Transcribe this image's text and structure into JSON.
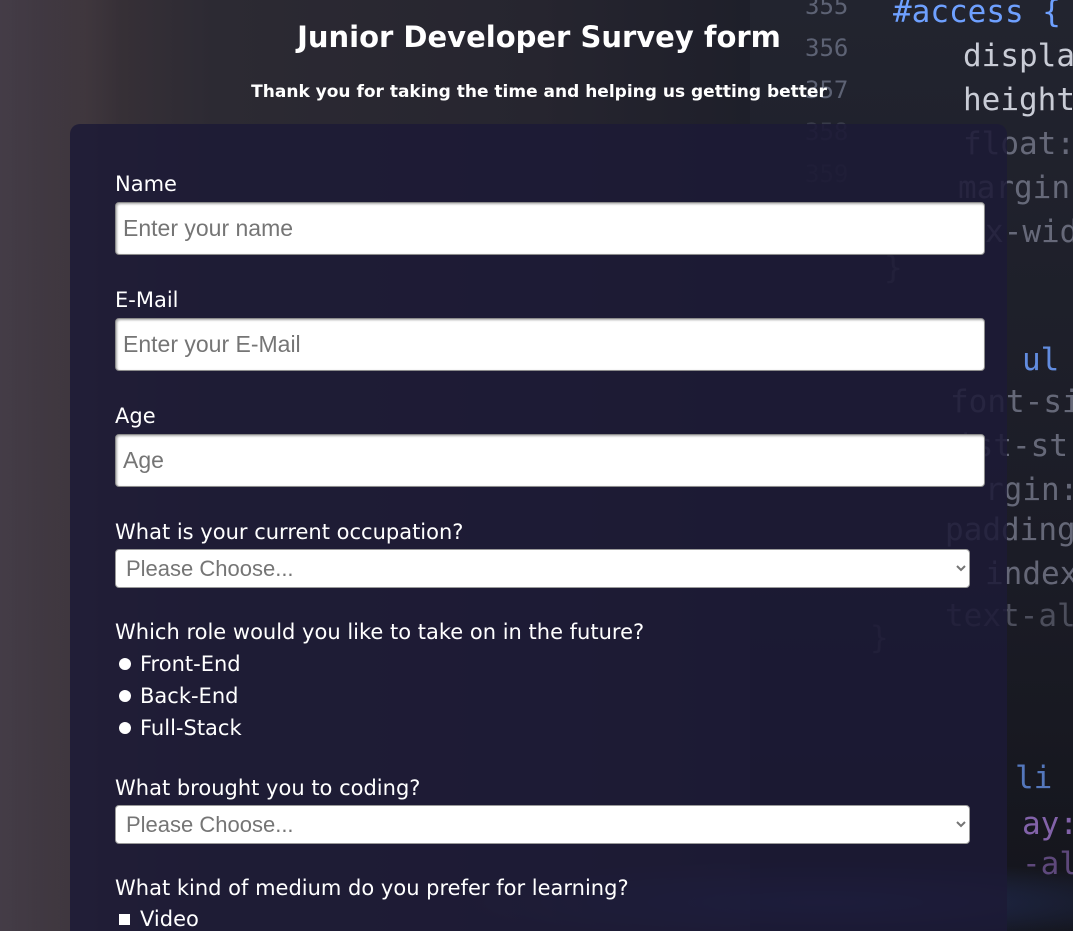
{
  "header": {
    "title": "Junior Developer Survey form",
    "subtitle": "Thank you for taking the time and helping us getting better"
  },
  "background_code": {
    "line_numbers": [
      "355",
      "356",
      "357",
      "358",
      "359"
    ],
    "lines": [
      "#access {",
      "displa",
      "height",
      "float:",
      "margin",
      "x-wid",
      "}",
      "ul",
      "font-si",
      "ist-st",
      "rgin:",
      "padding",
      "index",
      "text-al",
      "}",
      "li {",
      "ay:",
      "-alf"
    ]
  },
  "form": {
    "name": {
      "label": "Name",
      "placeholder": "Enter your name",
      "value": ""
    },
    "email": {
      "label": "E-Mail",
      "placeholder": "Enter your E-Mail",
      "value": ""
    },
    "age": {
      "label": "Age",
      "placeholder": "Age",
      "value": ""
    },
    "occupation": {
      "label": "What is your current occupation?",
      "selected": "Please Choose..."
    },
    "future_role": {
      "label": "Which role would you like to take on in the future?",
      "options": [
        "Front-End",
        "Back-End",
        "Full-Stack"
      ]
    },
    "coding_reason": {
      "label": "What brought you to coding?",
      "selected": "Please Choose..."
    },
    "learning_medium": {
      "label": "What kind of medium do you prefer for learning?",
      "options": [
        "Video"
      ]
    }
  },
  "colors": {
    "panel_background": "#1c1a36",
    "text": "#ffffff",
    "code_keyword": "#6ea0ff"
  }
}
